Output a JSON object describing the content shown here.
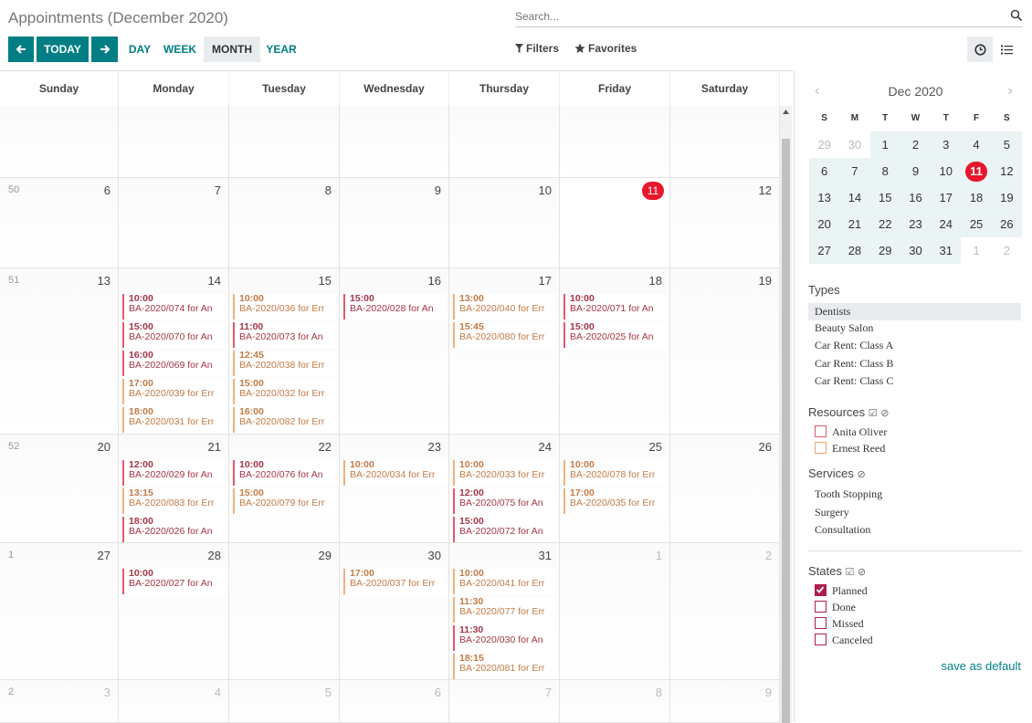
{
  "header": {
    "title": "Appointments (December 2020)",
    "search_placeholder": "Search...",
    "today_label": "TODAY",
    "scales": [
      "DAY",
      "WEEK",
      "MONTH",
      "YEAR"
    ],
    "filters_label": "Filters",
    "favorites_label": "Favorites"
  },
  "calendar": {
    "weekdays": [
      "Sunday",
      "Monday",
      "Tuesday",
      "Wednesday",
      "Thursday",
      "Friday",
      "Saturday"
    ],
    "weeks": [
      {
        "wk": "",
        "days": [
          "",
          "",
          "",
          "",
          "",
          "",
          ""
        ]
      },
      {
        "wk": "50",
        "days": [
          "6",
          "7",
          "8",
          "9",
          "10",
          "11",
          "12"
        ]
      },
      {
        "wk": "51",
        "days": [
          "13",
          "14",
          "15",
          "16",
          "17",
          "18",
          "19"
        ]
      },
      {
        "wk": "52",
        "days": [
          "20",
          "21",
          "22",
          "23",
          "24",
          "25",
          "26"
        ]
      },
      {
        "wk": "1",
        "days": [
          "27",
          "28",
          "29",
          "30",
          "31",
          "1",
          "2"
        ]
      },
      {
        "wk": "2",
        "days": [
          "3",
          "4",
          "5",
          "6",
          "7",
          "8",
          "9"
        ]
      }
    ],
    "today": "11",
    "events": [
      {
        "w": 2,
        "d": 1,
        "slot": 0,
        "time": "10:00",
        "label": "BA-2020/074 for An",
        "color": "c1"
      },
      {
        "w": 2,
        "d": 1,
        "slot": 1,
        "time": "15:00",
        "label": "BA-2020/070 for An",
        "color": "c1"
      },
      {
        "w": 2,
        "d": 1,
        "slot": 2,
        "time": "16:00",
        "label": "BA-2020/069 for An",
        "color": "c1"
      },
      {
        "w": 2,
        "d": 1,
        "slot": 3,
        "time": "17:00",
        "label": "BA-2020/039 for Err",
        "color": "c2"
      },
      {
        "w": 2,
        "d": 1,
        "slot": 4,
        "time": "18:00",
        "label": "BA-2020/031 for Err",
        "color": "c2"
      },
      {
        "w": 2,
        "d": 2,
        "slot": 0,
        "time": "10:00",
        "label": "BA-2020/036 for Err",
        "color": "c2"
      },
      {
        "w": 2,
        "d": 2,
        "slot": 1,
        "time": "11:00",
        "label": "BA-2020/073 for An",
        "color": "c1"
      },
      {
        "w": 2,
        "d": 2,
        "slot": 2,
        "time": "12:45",
        "label": "BA-2020/038 for Err",
        "color": "c2"
      },
      {
        "w": 2,
        "d": 2,
        "slot": 3,
        "time": "15:00",
        "label": "BA-2020/032 for Err",
        "color": "c2"
      },
      {
        "w": 2,
        "d": 2,
        "slot": 4,
        "time": "16:00",
        "label": "BA-2020/082 for Err",
        "color": "c2"
      },
      {
        "w": 2,
        "d": 3,
        "slot": 0,
        "time": "15:00",
        "label": "BA-2020/028 for An",
        "color": "c1"
      },
      {
        "w": 2,
        "d": 4,
        "slot": 0,
        "time": "13:00",
        "label": "BA-2020/040 for Err",
        "color": "c2"
      },
      {
        "w": 2,
        "d": 4,
        "slot": 1,
        "time": "15:45",
        "label": "BA-2020/080 for Err",
        "color": "c2"
      },
      {
        "w": 2,
        "d": 5,
        "slot": 0,
        "time": "10:00",
        "label": "BA-2020/071 for An",
        "color": "c1"
      },
      {
        "w": 2,
        "d": 5,
        "slot": 1,
        "time": "15:00",
        "label": "BA-2020/025 for An",
        "color": "c1"
      },
      {
        "w": 3,
        "d": 1,
        "slot": 0,
        "time": "12:00",
        "label": "BA-2020/029 for An",
        "color": "c1"
      },
      {
        "w": 3,
        "d": 1,
        "slot": 1,
        "time": "13:15",
        "label": "BA-2020/083 for Err",
        "color": "c2"
      },
      {
        "w": 3,
        "d": 1,
        "slot": 2,
        "time": "18:00",
        "label": "BA-2020/026 for An",
        "color": "c1"
      },
      {
        "w": 3,
        "d": 2,
        "slot": 0,
        "time": "10:00",
        "label": "BA-2020/076 for An",
        "color": "c1"
      },
      {
        "w": 3,
        "d": 2,
        "slot": 1,
        "time": "15:00",
        "label": "BA-2020/079 for Err",
        "color": "c2"
      },
      {
        "w": 3,
        "d": 3,
        "slot": 0,
        "time": "10:00",
        "label": "BA-2020/034 for Err",
        "color": "c2"
      },
      {
        "w": 3,
        "d": 4,
        "slot": 0,
        "time": "10:00",
        "label": "BA-2020/033 for Err",
        "color": "c2"
      },
      {
        "w": 3,
        "d": 4,
        "slot": 1,
        "time": "12:00",
        "label": "BA-2020/075 for An",
        "color": "c1"
      },
      {
        "w": 3,
        "d": 4,
        "slot": 2,
        "time": "15:00",
        "label": "BA-2020/072 for An",
        "color": "c1"
      },
      {
        "w": 3,
        "d": 5,
        "slot": 0,
        "time": "10:00",
        "label": "BA-2020/078 for Err",
        "color": "c2"
      },
      {
        "w": 3,
        "d": 5,
        "slot": 1,
        "time": "17:00",
        "label": "BA-2020/035 for Err",
        "color": "c2"
      },
      {
        "w": 4,
        "d": 1,
        "slot": 0,
        "time": "10:00",
        "label": "BA-2020/027 for An",
        "color": "c1"
      },
      {
        "w": 4,
        "d": 3,
        "slot": 0,
        "time": "17:00",
        "label": "BA-2020/037 for Err",
        "color": "c2"
      },
      {
        "w": 4,
        "d": 4,
        "slot": 0,
        "time": "10:00",
        "label": "BA-2020/041 for Err",
        "color": "c2"
      },
      {
        "w": 4,
        "d": 4,
        "slot": 1,
        "time": "11:30",
        "label": "BA-2020/077 for Err",
        "color": "c2"
      },
      {
        "w": 4,
        "d": 4,
        "slot": 2,
        "time": "11:30",
        "label": "BA-2020/030 for An",
        "color": "c1"
      },
      {
        "w": 4,
        "d": 4,
        "slot": 3,
        "time": "18:15",
        "label": "BA-2020/081 for Err",
        "color": "c2"
      }
    ]
  },
  "sidebar": {
    "mini_title": "Dec 2020",
    "mini_days": [
      "S",
      "M",
      "T",
      "W",
      "T",
      "F",
      "S"
    ],
    "mini_weeks": [
      [
        "29",
        "30",
        "1",
        "2",
        "3",
        "4",
        "5"
      ],
      [
        "6",
        "7",
        "8",
        "9",
        "10",
        "11",
        "12"
      ],
      [
        "13",
        "14",
        "15",
        "16",
        "17",
        "18",
        "19"
      ],
      [
        "20",
        "21",
        "22",
        "23",
        "24",
        "25",
        "26"
      ],
      [
        "27",
        "28",
        "29",
        "30",
        "31",
        "1",
        "2"
      ]
    ],
    "types_title": "Types",
    "types": [
      "Dentists",
      "Beauty Salon",
      "Car Rent: Class A",
      "Car Rent: Class B",
      "Car Rent: Class C"
    ],
    "resources_title": "Resources",
    "resources": [
      {
        "label": "Anita Oliver",
        "color": "#e05a6a"
      },
      {
        "label": "Ernest Reed",
        "color": "#f1a36c"
      }
    ],
    "services_title": "Services",
    "services": [
      "Tooth Stopping",
      "Surgery",
      "Consultation"
    ],
    "states_title": "States",
    "states": [
      {
        "label": "Planned",
        "checked": true
      },
      {
        "label": "Done",
        "checked": false
      },
      {
        "label": "Missed",
        "checked": false
      },
      {
        "label": "Canceled",
        "checked": false
      }
    ],
    "save_default": "save as default"
  }
}
